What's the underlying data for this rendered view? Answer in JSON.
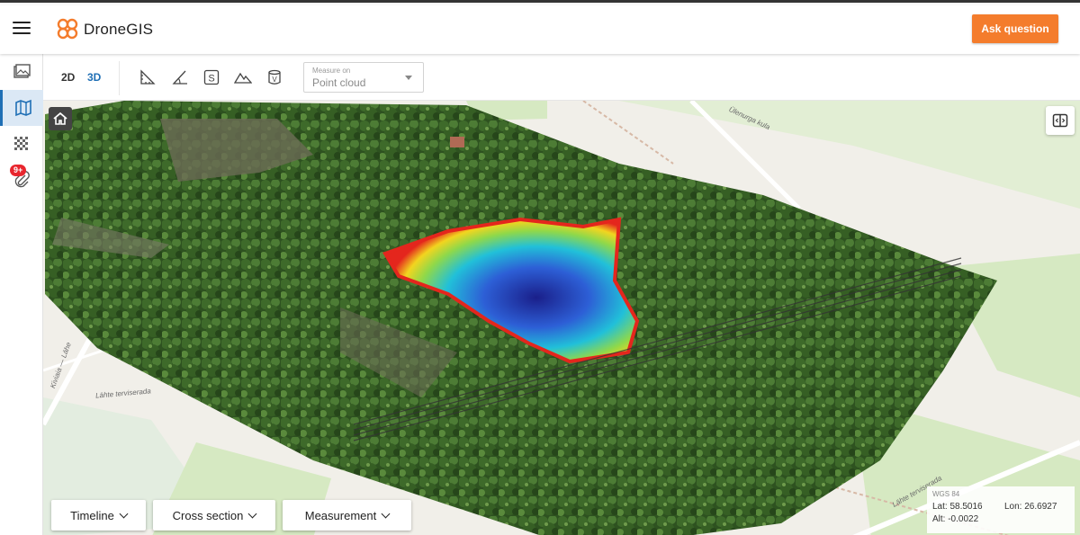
{
  "header": {
    "brand": "DroneGIS",
    "ask_button": "Ask question",
    "accent_color": "#f47c2c"
  },
  "sidebar": {
    "items": [
      {
        "icon": "gallery-icon",
        "active": false
      },
      {
        "icon": "map-icon",
        "active": true
      },
      {
        "icon": "point-cloud-icon",
        "active": false
      },
      {
        "icon": "attachment-icon",
        "active": false,
        "badge": "9+"
      }
    ],
    "active_color": "#1f6fb5"
  },
  "toolbar": {
    "mode_2d": "2D",
    "mode_3d": "3D",
    "active_mode": "3D",
    "tools": [
      "ruler-area-icon",
      "angle-icon",
      "surface-s-icon",
      "volume-mountain-icon",
      "volume-v-icon"
    ],
    "measure_on_label": "Measure on",
    "measure_on_value": "Point cloud"
  },
  "map": {
    "labels": {
      "street1": "Kiviaia — Lähe",
      "street2": "Lähte terviserada",
      "street3": "Lähte terviserada",
      "street4": "Ülenurga kula"
    },
    "colors": {
      "forest": "#2f5a22",
      "basemap": "#f1efe9",
      "green_area": "#d6e9c2"
    }
  },
  "bottom_bar": {
    "timeline": "Timeline",
    "cross_section": "Cross section",
    "measurement": "Measurement"
  },
  "coordinates": {
    "system": "WGS 84",
    "lat": "Lat: 58.5016",
    "lon": "Lon: 26.6927",
    "alt": "Alt: -0.0022"
  }
}
